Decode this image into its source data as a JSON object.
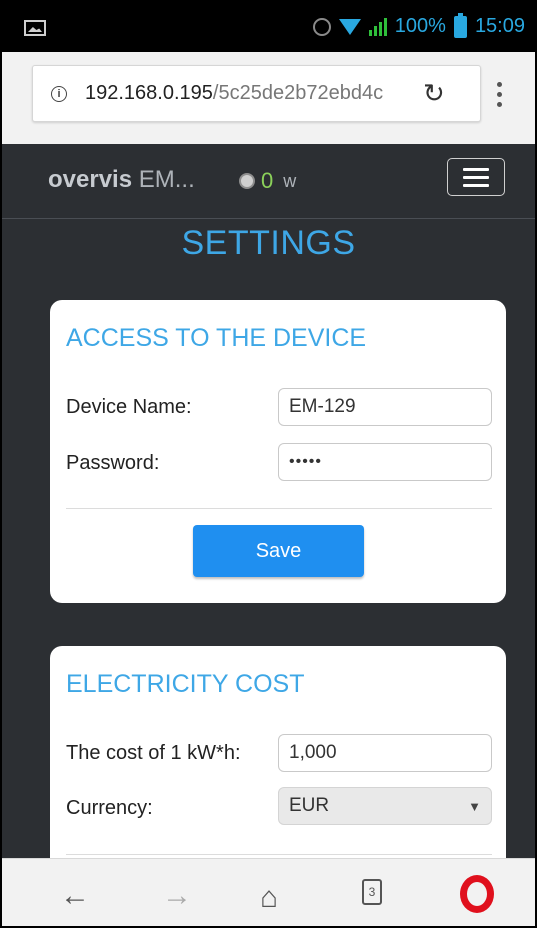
{
  "status_bar": {
    "battery": "100%",
    "time": "15:09",
    "icons": [
      "image-icon",
      "alarm-icon",
      "wifi-icon",
      "signal-icon",
      "battery-icon"
    ]
  },
  "browser": {
    "url_host": "192.168.0.195",
    "url_path": "/5c25de2b72ebd4c",
    "icons": [
      "info-icon",
      "reload-icon",
      "kebab-menu-icon"
    ]
  },
  "navbar": {
    "brand_bold": "overvis",
    "brand_rest": " EM...",
    "power_value": "0",
    "power_unit": "w"
  },
  "page": {
    "title": "SETTINGS"
  },
  "access_card": {
    "title": "ACCESS TO THE DEVICE",
    "device_name_label": "Device Name:",
    "device_name_value": "EM-129",
    "password_label": "Password:",
    "password_value": "•••••",
    "save_label": "Save"
  },
  "cost_card": {
    "title": "ELECTRICITY COST",
    "cost_label": "The cost of 1 kW*h:",
    "cost_value": "1,000",
    "currency_label": "Currency:",
    "currency_value": "EUR"
  },
  "bottom_nav": {
    "tab_count": "3",
    "icons": [
      "back-arrow-icon",
      "forward-arrow-icon",
      "home-icon",
      "tabs-icon",
      "opera-icon"
    ]
  },
  "colors": {
    "accent": "#3ea7e6",
    "page_bg": "#2c2f33",
    "button": "#1f8ff0",
    "power_value": "#8bd15a"
  }
}
